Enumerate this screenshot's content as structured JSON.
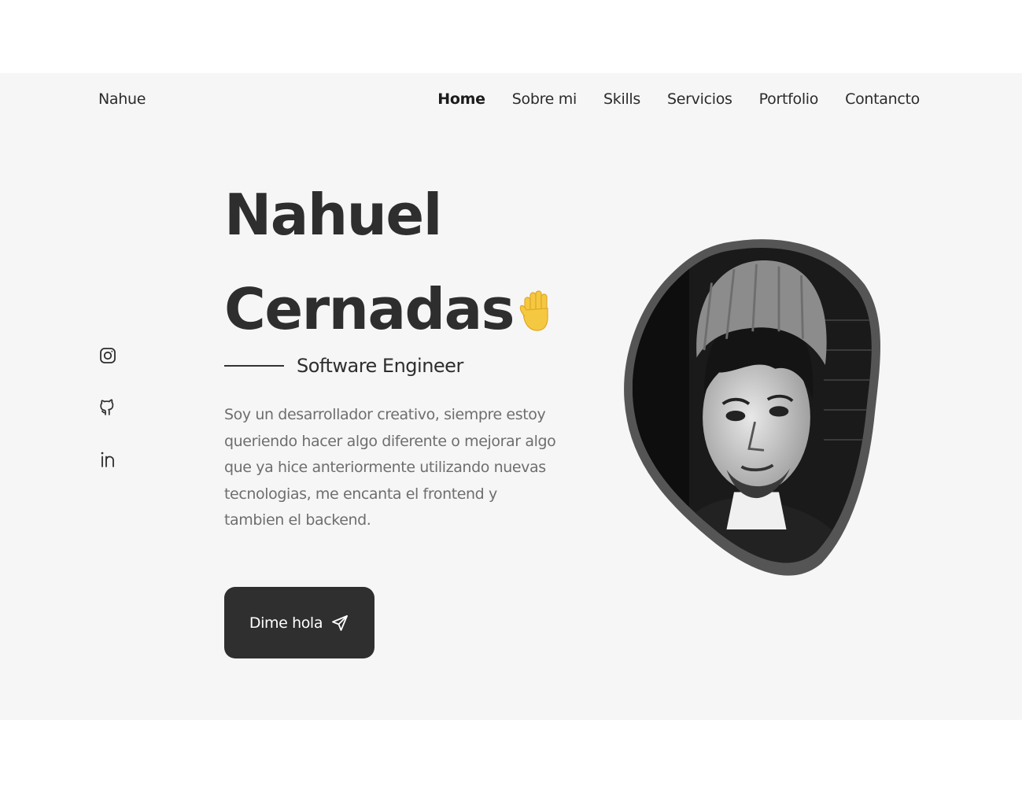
{
  "header": {
    "brand": "Nahue",
    "nav": [
      {
        "label": "Home",
        "active": true
      },
      {
        "label": "Sobre mi"
      },
      {
        "label": "Skills"
      },
      {
        "label": "Servicios"
      },
      {
        "label": "Portfolio"
      },
      {
        "label": "Contancto"
      }
    ]
  },
  "socials": [
    {
      "icon": "instagram-icon"
    },
    {
      "icon": "github-icon"
    },
    {
      "icon": "linkedin-icon"
    }
  ],
  "hero": {
    "first_name": "Nahuel",
    "last_name": "Cernadas",
    "wave_icon": "waving-hand-icon",
    "subtitle": "Software Engineer",
    "description": "Soy un desarrollador creativo, siempre estoy queriendo hacer algo diferente o mejorar algo que ya hice anteriormente utilizando nuevas tecnologias, me encanta el frontend y tambien el backend.",
    "cta_label": "Dime hola",
    "cta_icon": "send-icon"
  },
  "colors": {
    "background": "#f6f6f6",
    "text_dark": "#2e2e2e",
    "text_muted": "#6e6e6e",
    "button_bg": "#2f2f2f",
    "accent_hand": "#f5c842"
  }
}
